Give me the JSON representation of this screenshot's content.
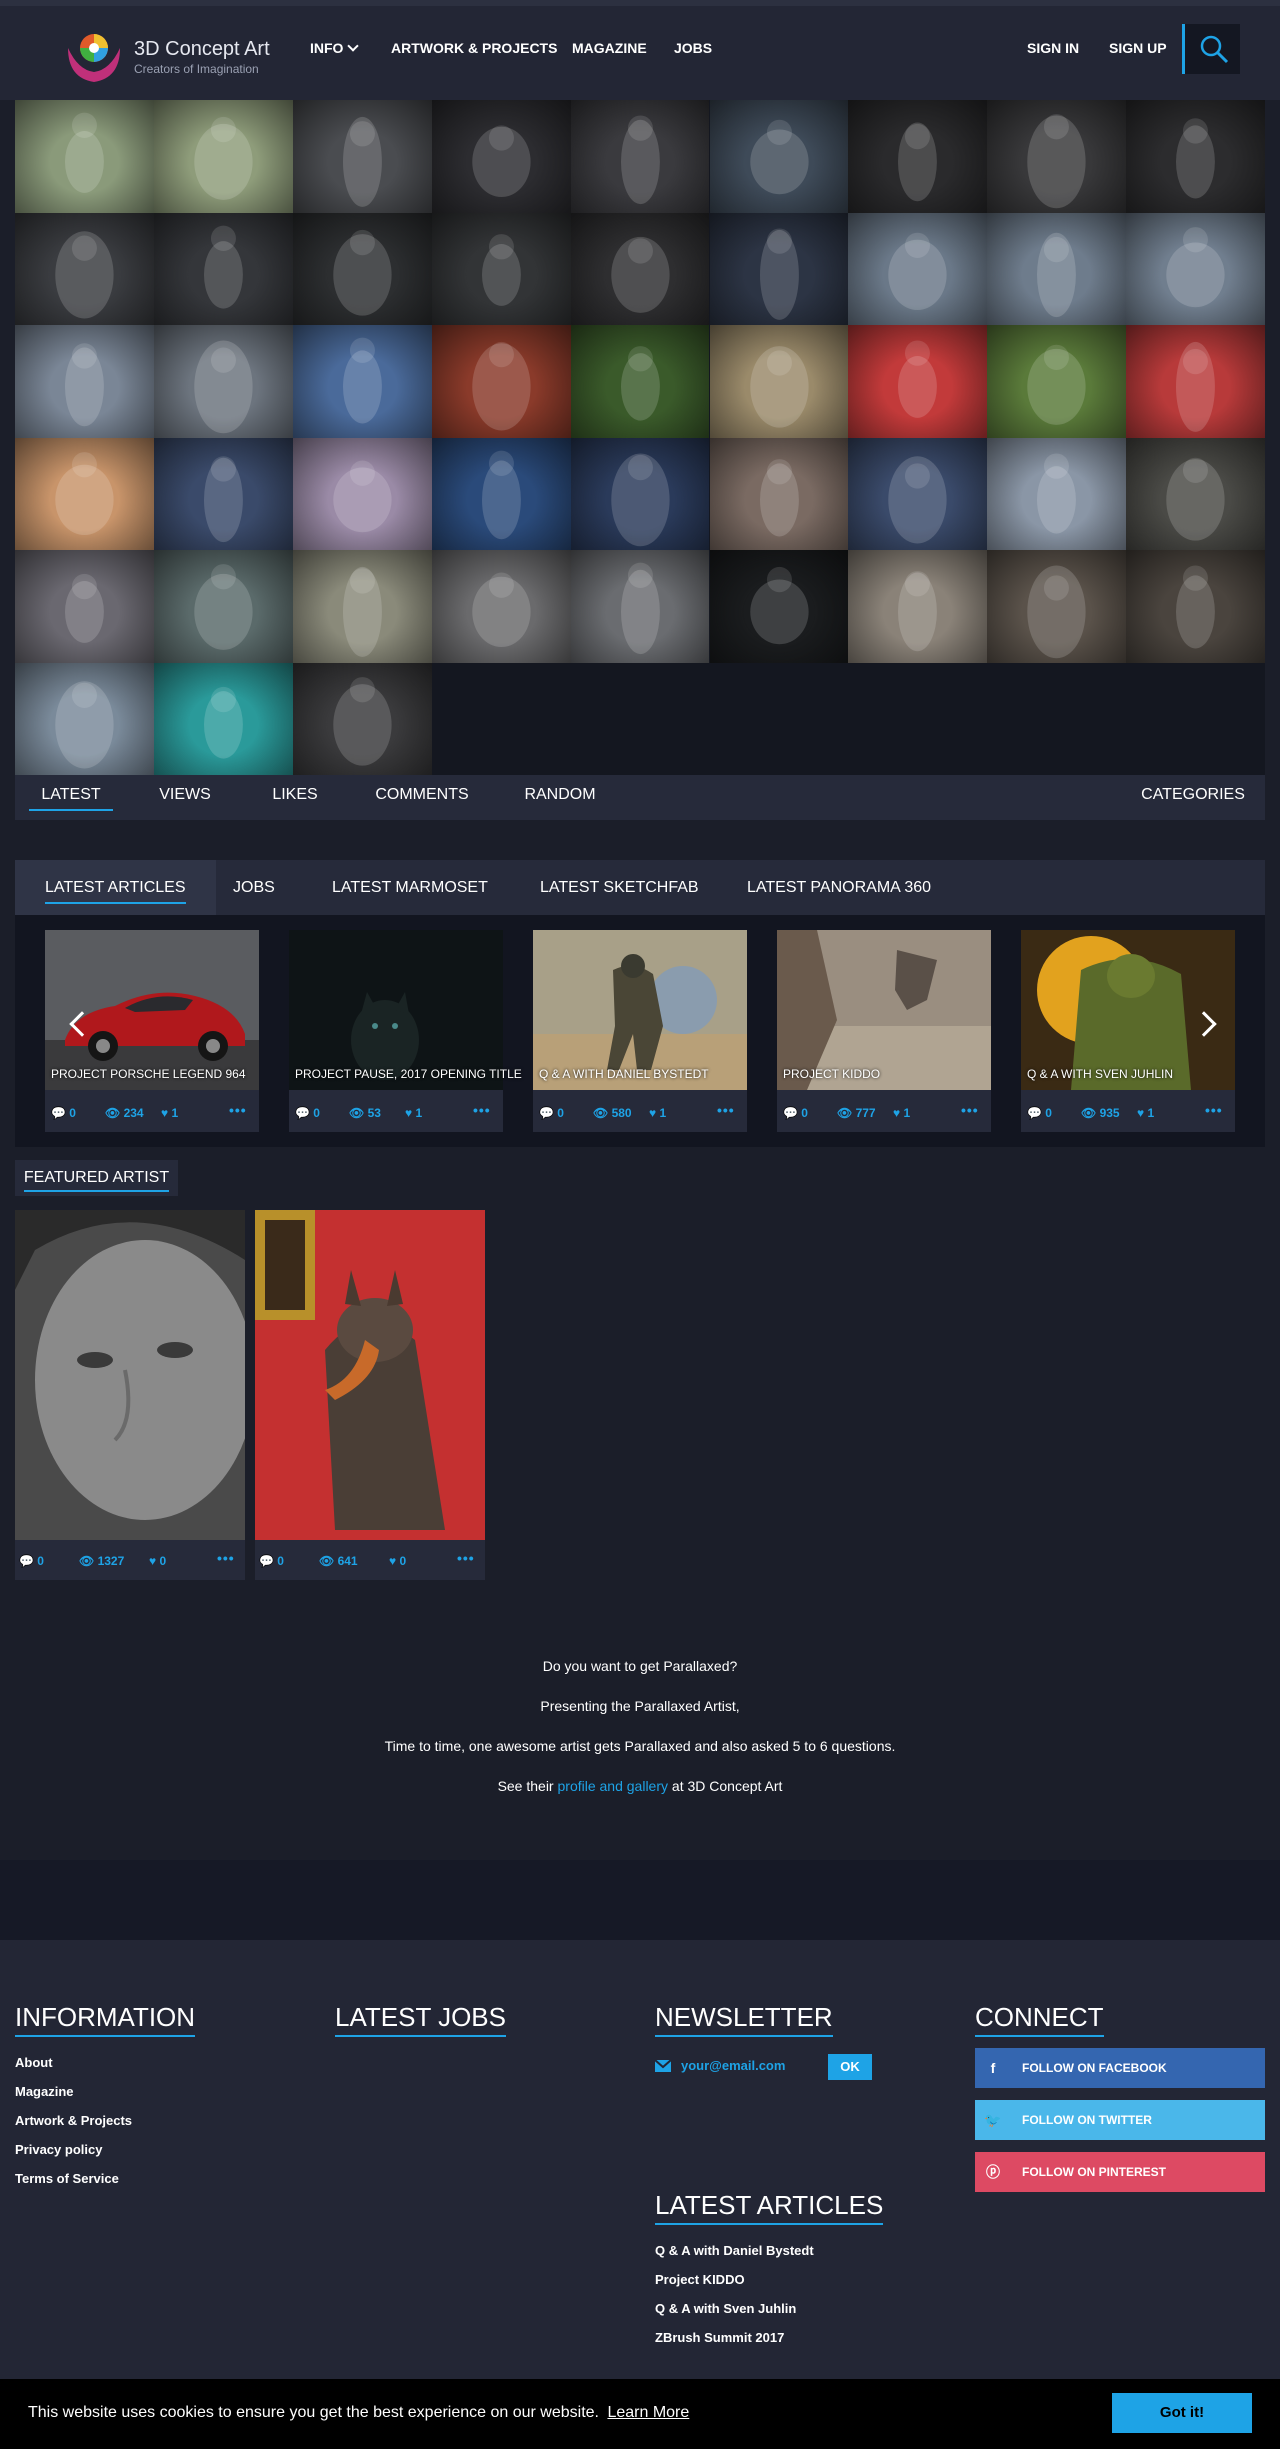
{
  "brand": {
    "title": "3D Concept Art",
    "subtitle": "Creators of Imagination"
  },
  "nav": {
    "info": "INFO",
    "artwork": "ARTWORK & PROJECTS",
    "magazine": "MAGAZINE",
    "jobs": "JOBS",
    "signin": "SIGN IN",
    "signup": "SIGN UP"
  },
  "gallery": {
    "colors": [
      "#8a9a7a",
      "#8e9c7a",
      "#4a4c50",
      "#2c2c30",
      "#3a3a3e",
      "#3e4a58",
      "#2a2a2c",
      "#38383a",
      "#2c2c2e",
      "#3a3c40",
      "#34363a",
      "#2c2e30",
      "#323436",
      "#2e2e30",
      "#2c3444",
      "#6a7888",
      "#6e7c8c",
      "#707e8e",
      "#7a8696",
      "#6c747e",
      "#4a6a9a",
      "#8a3a2a",
      "#3a5a2a",
      "#9a8a6a",
      "#c23a3a",
      "#5a7a3a",
      "#b83a3a",
      "#c8946a",
      "#3a4a6a",
      "#9a8aa6",
      "#2a4a7a",
      "#2a3a5a",
      "#7a6a62",
      "#3a4a6a",
      "#8a96a6",
      "#4a4a46",
      "#6a6870",
      "#5a6a6a",
      "#8a8a7a",
      "#6a6a6c",
      "#6a6c70",
      "#1a1c1e",
      "#8a8278",
      "#5a524a",
      "#4a443e",
      "#7a8a9a",
      "#2a9a9a",
      "#3a3a3c"
    ]
  },
  "sort": {
    "latest": "LATEST",
    "views": "VIEWS",
    "likes": "LIKES",
    "comments": "COMMENTS",
    "random": "RANDOM",
    "categories": "CATEGORIES"
  },
  "articles": {
    "tabs": [
      "LATEST ARTICLES",
      "JOBS",
      "LATEST MARMOSET",
      "LATEST SKETCHFAB",
      "LATEST PANORAMA 360"
    ],
    "cards": [
      {
        "title": "PROJECT PORSCHE LEGEND 964",
        "comments": "0",
        "views": "234",
        "likes": "1"
      },
      {
        "title": "PROJECT PAUSE, 2017 OPENING TITLE",
        "comments": "0",
        "views": "53",
        "likes": "1"
      },
      {
        "title": "Q & A WITH DANIEL BYSTEDT",
        "comments": "0",
        "views": "580",
        "likes": "1"
      },
      {
        "title": "PROJECT KIDDO",
        "comments": "0",
        "views": "777",
        "likes": "1"
      },
      {
        "title": "Q & A WITH SVEN JUHLIN",
        "comments": "0",
        "views": "935",
        "likes": "1"
      }
    ]
  },
  "featured": {
    "heading": "FEATURED ARTIST",
    "cards": [
      {
        "comments": "0",
        "views": "1327",
        "likes": "0"
      },
      {
        "comments": "0",
        "views": "641",
        "likes": "0"
      }
    ]
  },
  "parallax": {
    "line1": "Do you want to get Parallaxed?",
    "line2": "Presenting the Parallaxed Artist,",
    "line3": "Time to time, one awesome artist gets Parallaxed and also asked 5 to 6 questions.",
    "line4_pre": "See their",
    "line4_link": "profile and gallery",
    "line4_post": "at 3D Concept Art"
  },
  "footer": {
    "information": {
      "heading": "INFORMATION",
      "links": [
        "About",
        "Magazine",
        "Artwork & Projects",
        "Privacy policy",
        "Terms of Service"
      ]
    },
    "jobs": {
      "heading": "LATEST JOBS"
    },
    "newsletter": {
      "heading": "NEWSLETTER",
      "placeholder": "your@email.com",
      "ok": "OK"
    },
    "latest_articles": {
      "heading": "LATEST ARTICLES",
      "links": [
        "Q & A with Daniel Bystedt",
        "Project KIDDO",
        "Q & A with Sven Juhlin",
        "ZBrush Summit 2017"
      ]
    },
    "connect": {
      "heading": "CONNECT",
      "facebook": "FOLLOW ON FACEBOOK",
      "twitter": "FOLLOW ON TWITTER",
      "pinterest": "FOLLOW ON PINTEREST",
      "facebook_color": "#3466b0",
      "twitter_color": "#4ab7ea",
      "pinterest_color": "#dd4a63"
    }
  },
  "cookie": {
    "message": "This website uses cookies to ensure you get the best experience on our website.",
    "learn_more": "Learn More",
    "button": "Got it!"
  },
  "colors": {
    "accent": "#1ea3e6",
    "background": "#1b1e29",
    "panel": "#262a3a"
  }
}
